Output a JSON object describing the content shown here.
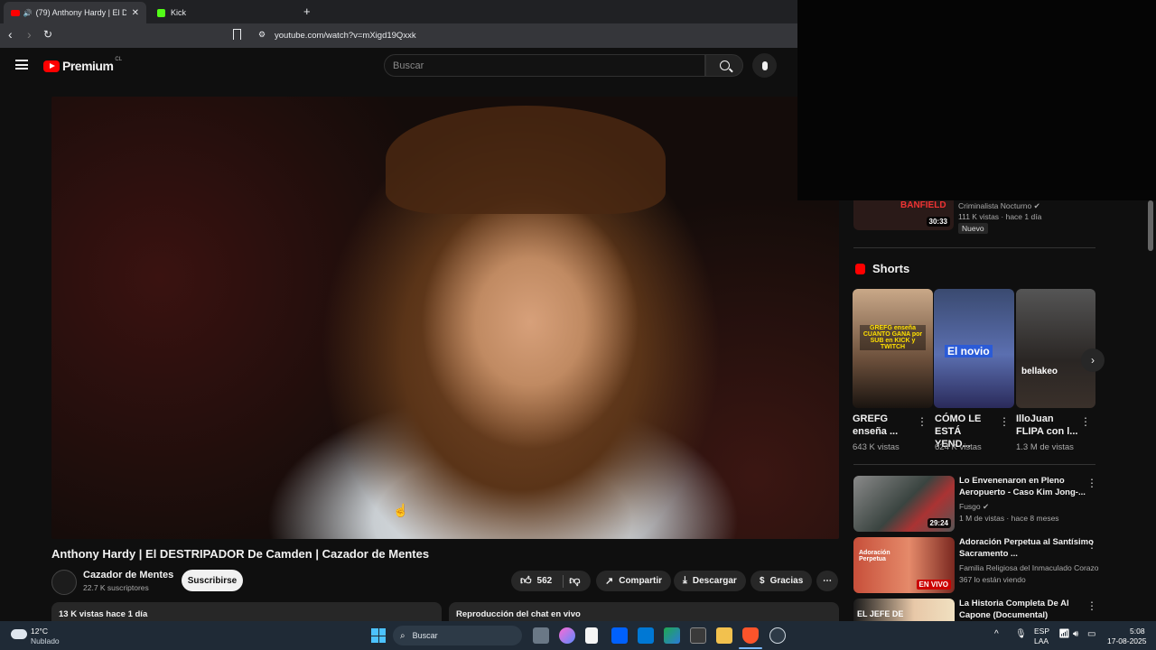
{
  "browser": {
    "tabs": [
      {
        "title": "(79) Anthony Hardy | El DESTR",
        "active": true
      },
      {
        "title": "Kick",
        "active": false
      }
    ],
    "url": "youtube.com/watch?v=mXigd19Qxxk"
  },
  "youtube": {
    "logo": "Premium",
    "logo_badge": "CL",
    "search_placeholder": "Buscar"
  },
  "video": {
    "title": "Anthony Hardy | El DESTRIPADOR De Camden | Cazador de Mentes",
    "channel": "Cazador de Mentes",
    "subscribers": "22.7 K suscriptores",
    "subscribe_label": "Suscribirse",
    "likes": "562",
    "share_label": "Compartir",
    "download_label": "Descargar",
    "thanks_label": "Gracias",
    "views_date": "13 K vistas  hace 1 día",
    "chat_replay_label": "Reproducción del chat en vivo"
  },
  "sidebar": {
    "top_item": {
      "thumb_text": "BANFIELD",
      "duration": "30:33",
      "channel": "Criminalista Nocturno",
      "meta": "111 K vistas · hace 1 día",
      "badge": "Nuevo"
    },
    "shorts_heading": "Shorts",
    "shorts": [
      {
        "title": "GREFG enseña ...",
        "views": "643 K vistas",
        "overlay": "GREFG enseña CUANTO GANA por SUB en KICK y TWITCH"
      },
      {
        "title": "CÓMO LE ESTÁ YEND...",
        "views": "624 K vistas",
        "overlay": "El novio"
      },
      {
        "title": "IlloJuan FLIPA con l...",
        "views": "1.3 M de vistas",
        "overlay": "bellakeo"
      }
    ],
    "videos": [
      {
        "title": "Lo Envenenaron en Pleno Aeropuerto - Caso Kim Jong-...",
        "channel": "Fusgo",
        "meta": "1 M de vistas · hace 8 meses",
        "duration": "29:24"
      },
      {
        "title": "Adoración Perpetua al Santísimo Sacramento ...",
        "channel": "Familia Religiosa del Inmaculado Corazo...",
        "meta": "367 lo están viendo",
        "thumb_text": "Adoración Perpetua",
        "live_label": "EN VIVO"
      },
      {
        "title": "La Historia Completa De Al Capone (Documental)",
        "channel": "",
        "meta": "",
        "thumb_text": "EL JEFE DE"
      }
    ]
  },
  "taskbar": {
    "weather_temp": "12°C",
    "weather_desc": "Nublado",
    "search_label": "Buscar",
    "lang_line1": "ESP",
    "lang_line2": "LAA",
    "time": "5:08",
    "date": "17-08-2025"
  },
  "colors": {
    "yt_red": "#ff0000",
    "background": "#0f0f0f",
    "taskbar": "#1f2a36"
  }
}
